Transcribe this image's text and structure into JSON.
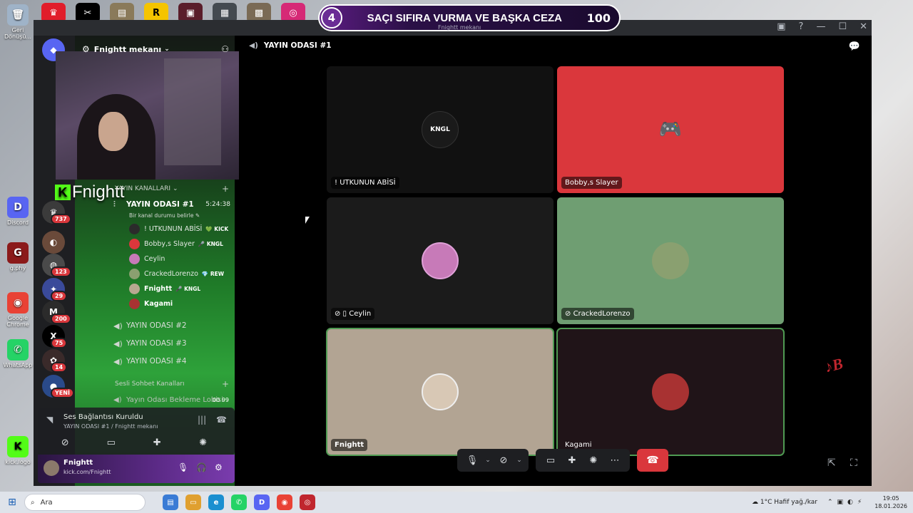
{
  "desktop": {
    "left_icons": [
      {
        "label": "Geri Dönüşü...",
        "color": "#9fb3c8",
        "glyph": "🗑"
      },
      {
        "label": "Discord",
        "color": "#5865f2",
        "glyph": "D"
      },
      {
        "label": "g.phy",
        "color": "#8b1a1a",
        "glyph": "G"
      },
      {
        "label": "Google Chrome",
        "color": "#e94235",
        "glyph": "◉"
      },
      {
        "label": "WhatsApp",
        "color": "#25d366",
        "glyph": "✆"
      },
      {
        "label": "kick.logo",
        "color": "#53fc18",
        "glyph": "K"
      }
    ],
    "top_icons": [
      {
        "color": "#e11d2a",
        "glyph": "♛"
      },
      {
        "color": "#000000",
        "glyph": "✂"
      },
      {
        "color": "#8a7a5a",
        "glyph": "▤"
      },
      {
        "color": "#f5c400",
        "glyph": "R"
      },
      {
        "color": "#5a1d2a",
        "glyph": "▣"
      },
      {
        "color": "#444a50",
        "glyph": "▦"
      },
      {
        "color": "#7a6a55",
        "glyph": "▩"
      },
      {
        "color": "#d62976",
        "glyph": "◎"
      }
    ]
  },
  "overlay": {
    "number": "4",
    "text": "SAÇI SIFIRA VURMA VE BAŞKA CEZA",
    "score": "100",
    "sub": "Fnightt mekanı"
  },
  "window": {
    "controls": [
      "▣",
      "?",
      "—",
      "☐",
      "✕"
    ]
  },
  "rail": {
    "servers": [
      {
        "glyph": "◆",
        "color": "#5865f2",
        "badge": ""
      },
      {
        "glyph": "♛",
        "color": "#3b3b3b",
        "badge": "737"
      },
      {
        "glyph": "◐",
        "color": "#6a4a3a",
        "badge": ""
      },
      {
        "glyph": "◍",
        "color": "#4a4a4a",
        "badge": "123"
      },
      {
        "glyph": "✦",
        "color": "#3a4a9a",
        "badge": "29"
      },
      {
        "glyph": "M",
        "color": "#2b2b2b",
        "badge": "200"
      },
      {
        "glyph": "X",
        "color": "#000000",
        "badge": "75"
      },
      {
        "glyph": "✿",
        "color": "#3a2a2a",
        "badge": "14"
      },
      {
        "glyph": "●",
        "color": "#2a4a8a",
        "badge": "YENİ"
      }
    ]
  },
  "sidebar": {
    "server_name": "Fnightt mekanı",
    "kick_name": "Fnightt",
    "category1": "YAYIN KANALLARI",
    "active_channel": {
      "name": "YAYIN ODASI #1",
      "timer": "5:24:38",
      "status": "Bir kanal durumu belirle"
    },
    "members": [
      {
        "name": "! UTKUNUN ABİSİ",
        "tag": "💚 KICK",
        "avatar": "#2b2b2b",
        "muted": false,
        "bold": false
      },
      {
        "name": "Bobby,s Slayer",
        "tag": "🎤 KNGL",
        "avatar": "#da373c",
        "muted": false,
        "bold": false
      },
      {
        "name": "Ceylin",
        "tag": "",
        "avatar": "#c77ab8",
        "muted": true,
        "bold": false
      },
      {
        "name": "CrackedLorenzo",
        "tag": "💎 REW",
        "avatar": "#8aa070",
        "muted": true,
        "bold": false
      },
      {
        "name": "Fnightt",
        "tag": "🎤 KNGL",
        "avatar": "#b8a890",
        "muted": false,
        "bold": true
      },
      {
        "name": "Kagami",
        "tag": "",
        "avatar": "#a83232",
        "muted": false,
        "bold": true
      }
    ],
    "channels": [
      "YAYIN ODASI #2",
      "YAYIN ODASI #3",
      "YAYIN ODASI #4"
    ],
    "category2": "Sesli Sohbet Kanalları",
    "lobby": {
      "name": "Yayın Odası Bekleme Lobisi",
      "count": "00  99"
    },
    "voice": {
      "title": "Ses Bağlantısı Kuruldu",
      "sub": "YAYIN ODASI #1 / Fnightt mekanı"
    },
    "user": {
      "name": "Fnightt",
      "status": "kick.com/Fnightt"
    }
  },
  "main": {
    "channel_title": "YAYIN ODASI #1",
    "tiles": [
      {
        "name": "! UTKUNUN ABİSİ",
        "bg": "#111111",
        "avatar": "#1a1a1a",
        "avatar_text": "KNGL",
        "speaking": false
      },
      {
        "name": "Bobby,s Slayer",
        "bg": "#da373c",
        "avatar": "#da373c",
        "avatar_text": "🎮",
        "speaking": false
      },
      {
        "name": "Ceylin",
        "bg": "#1b1b1b",
        "avatar": "#c77ab8",
        "avatar_text": "",
        "speaking": false
      },
      {
        "name": "CrackedLorenzo",
        "bg": "#6f9e72",
        "avatar": "#8aa070",
        "avatar_text": "",
        "speaking": false
      },
      {
        "name": "Fnightt",
        "bg": "#b2a493",
        "avatar": "#d8c8b5",
        "avatar_text": "",
        "speaking": true
      },
      {
        "name": "Kagami",
        "bg": "#201418",
        "avatar": "#a83232",
        "avatar_text": "",
        "speaking": true
      }
    ],
    "tile_icons": {
      "Ceylin": "✎ ▯",
      "CrackedLorenzo": "✎"
    }
  },
  "taskbar": {
    "search_placeholder": "Ara",
    "weather": "1°C  Hafif yağ./kar",
    "time": "19:05",
    "date": "18.01.2026",
    "apps": [
      {
        "color": "#3a7bd5",
        "glyph": "▤"
      },
      {
        "color": "#e0a030",
        "glyph": "▭"
      },
      {
        "color": "#1a8fd0",
        "glyph": "e"
      },
      {
        "color": "#25d366",
        "glyph": "✆"
      },
      {
        "color": "#5865f2",
        "glyph": "D"
      },
      {
        "color": "#e94235",
        "glyph": "◉"
      },
      {
        "color": "#c0262e",
        "glyph": "◎"
      }
    ]
  }
}
